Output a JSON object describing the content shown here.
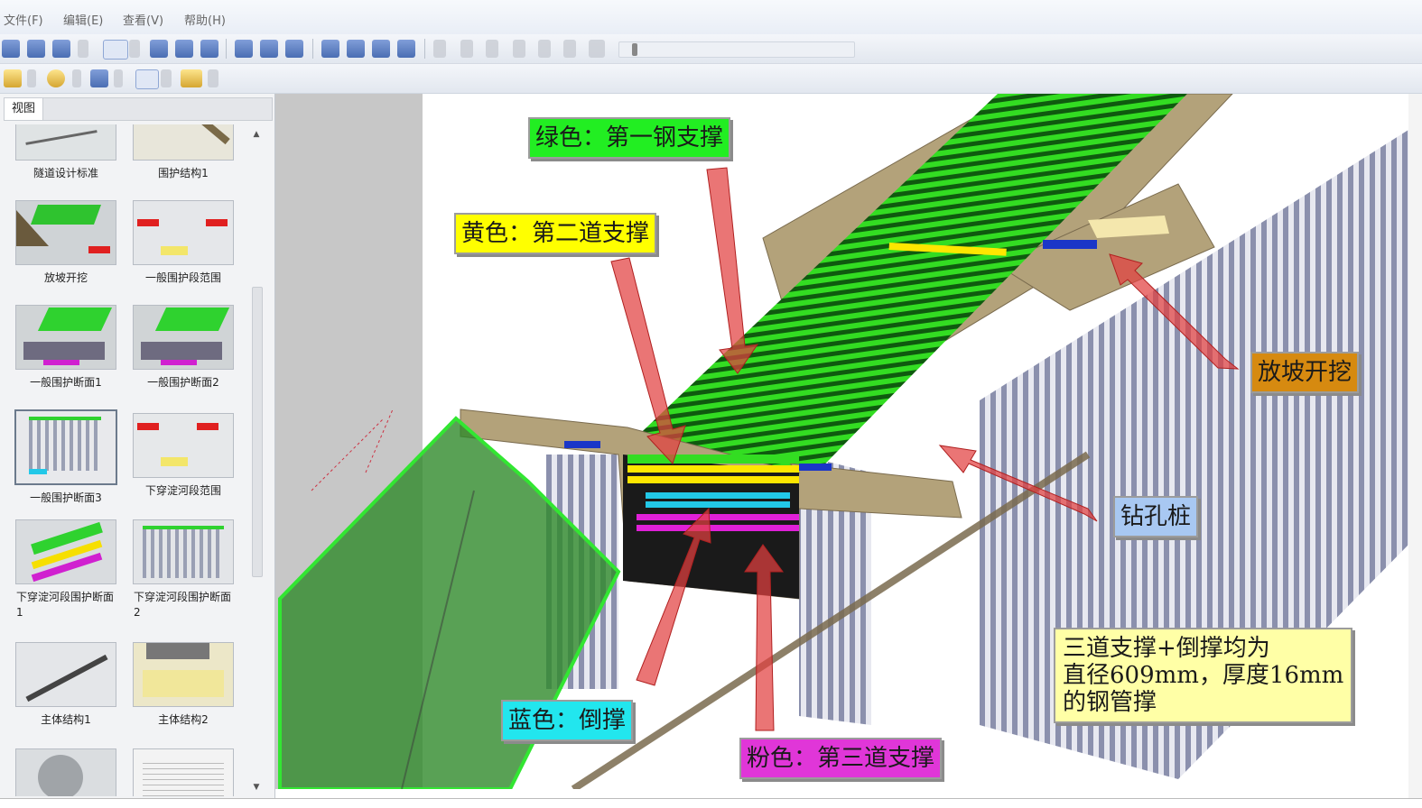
{
  "menu": [
    "文件(F)",
    "编辑(E)",
    "查看(V)",
    "帮助(H)"
  ],
  "panel": {
    "tab_label": "视图",
    "thumbnails": [
      {
        "label": "隧道设计标准"
      },
      {
        "label": "围护结构1"
      },
      {
        "label": "放坡开挖"
      },
      {
        "label": "一般围护段范围"
      },
      {
        "label": "一般围护断面1"
      },
      {
        "label": "一般围护断面2"
      },
      {
        "label": "一般围护断面3"
      },
      {
        "label": "下穿淀河段范围"
      },
      {
        "label": "下穿淀河段围护断面1"
      },
      {
        "label": "下穿淀河段围护断面2"
      },
      {
        "label": "主体结构1"
      },
      {
        "label": "主体结构2"
      }
    ],
    "selected_index": 6
  },
  "annotations": {
    "green_label": "绿色：第一钢支撑",
    "yellow_label": "黄色：第二道支撑",
    "blue_label": "蓝色：倒撑",
    "pink_label": "粉色：第三道支撑",
    "slope_label": "放坡开挖",
    "pile_label": "钻孔桩",
    "note_line1": "三道支撑+倒撑均为",
    "note_line2": "直径609mm，厚度16mm",
    "note_line3": "的钢管撑"
  },
  "colors": {
    "green_strut": "#33dd22",
    "yellow_strut": "#ffe600",
    "cyan_strut": "#22c8e8",
    "pink_strut": "#e020d8",
    "pile": "#8a8fb0",
    "soil": "#b3a27a",
    "arrow": "#e24040"
  },
  "icons": [
    "open-icon",
    "save-icon",
    "undo-icon",
    "redo-icon",
    "zoom-fit-icon",
    "grid-icon",
    "link-icon",
    "info-icon",
    "camera-icon",
    "orbit-icon",
    "select-icon",
    "nav-1-icon",
    "nav-2-icon",
    "nav-3-icon",
    "nav-4-icon",
    "first-frame-icon",
    "prev-frame-icon",
    "play-icon",
    "pause-icon",
    "stop-icon",
    "last-frame-icon",
    "loop-icon",
    "light-icon",
    "material-icon",
    "render-icon",
    "move-icon",
    "pencil-icon"
  ]
}
